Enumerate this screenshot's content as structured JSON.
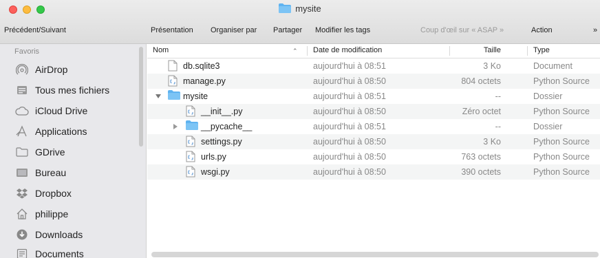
{
  "window": {
    "title": "mysite"
  },
  "toolbar": {
    "nav_label": "Précédent/Suivant",
    "view_label": "Présentation",
    "arrange_label": "Organiser par",
    "share_label": "Partager",
    "tags_label": "Modifier les tags",
    "quicklook_label": "Coup d'œil sur « ASAP »",
    "action_label": "Action",
    "overflow_label": "»"
  },
  "sidebar": {
    "header": "Favoris",
    "items": [
      {
        "label": "AirDrop",
        "icon": "airdrop-icon"
      },
      {
        "label": "Tous mes fichiers",
        "icon": "all-files-icon"
      },
      {
        "label": "iCloud Drive",
        "icon": "cloud-icon"
      },
      {
        "label": "Applications",
        "icon": "applications-icon"
      },
      {
        "label": "GDrive",
        "icon": "folder-icon"
      },
      {
        "label": "Bureau",
        "icon": "desktop-icon"
      },
      {
        "label": "Dropbox",
        "icon": "dropbox-icon"
      },
      {
        "label": "philippe",
        "icon": "home-icon"
      },
      {
        "label": "Downloads",
        "icon": "downloads-icon"
      },
      {
        "label": "Documents",
        "icon": "documents-icon"
      }
    ]
  },
  "columns": {
    "name": "Nom",
    "date": "Date de modification",
    "size": "Taille",
    "type": "Type"
  },
  "files": [
    {
      "name": "db.sqlite3",
      "date": "aujourd'hui à 08:51",
      "size": "3 Ko",
      "type": "Document",
      "kind": "document",
      "indent": 0,
      "disclosure": ""
    },
    {
      "name": "manage.py",
      "date": "aujourd'hui à 08:50",
      "size": "804 octets",
      "type": "Python Source",
      "kind": "python",
      "indent": 0,
      "disclosure": ""
    },
    {
      "name": "mysite",
      "date": "aujourd'hui à 08:51",
      "size": "--",
      "type": "Dossier",
      "kind": "folder",
      "indent": 0,
      "disclosure": "open"
    },
    {
      "name": "__init__.py",
      "date": "aujourd'hui à 08:50",
      "size": "Zéro octet",
      "type": "Python Source",
      "kind": "python",
      "indent": 1,
      "disclosure": ""
    },
    {
      "name": "__pycache__",
      "date": "aujourd'hui à 08:51",
      "size": "--",
      "type": "Dossier",
      "kind": "folder",
      "indent": 1,
      "disclosure": "closed"
    },
    {
      "name": "settings.py",
      "date": "aujourd'hui à 08:50",
      "size": "3 Ko",
      "type": "Python Source",
      "kind": "python",
      "indent": 1,
      "disclosure": ""
    },
    {
      "name": "urls.py",
      "date": "aujourd'hui à 08:50",
      "size": "763 octets",
      "type": "Python Source",
      "kind": "python",
      "indent": 1,
      "disclosure": ""
    },
    {
      "name": "wsgi.py",
      "date": "aujourd'hui à 08:50",
      "size": "390 octets",
      "type": "Python Source",
      "kind": "python",
      "indent": 1,
      "disclosure": ""
    }
  ],
  "colors": {
    "folder": "#5fb3f0",
    "selection": "#f4f5f5"
  }
}
